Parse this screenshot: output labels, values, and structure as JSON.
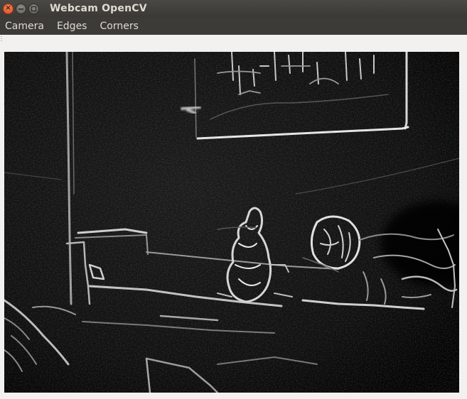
{
  "window": {
    "title": "Webcam OpenCV",
    "controls": {
      "close_glyph": "×",
      "minimize_icon": "minimize-icon",
      "maximize_icon": "maximize-icon"
    }
  },
  "menubar": {
    "items": [
      {
        "label": "Camera"
      },
      {
        "label": "Edges"
      },
      {
        "label": "Corners"
      }
    ]
  },
  "colors": {
    "titlebar_bg": "#3c3b37",
    "title_text": "#dfdbd2",
    "close_button": "#e0481f",
    "window_bg": "#f2f1f0",
    "video_bg": "#0d0d0d"
  }
}
